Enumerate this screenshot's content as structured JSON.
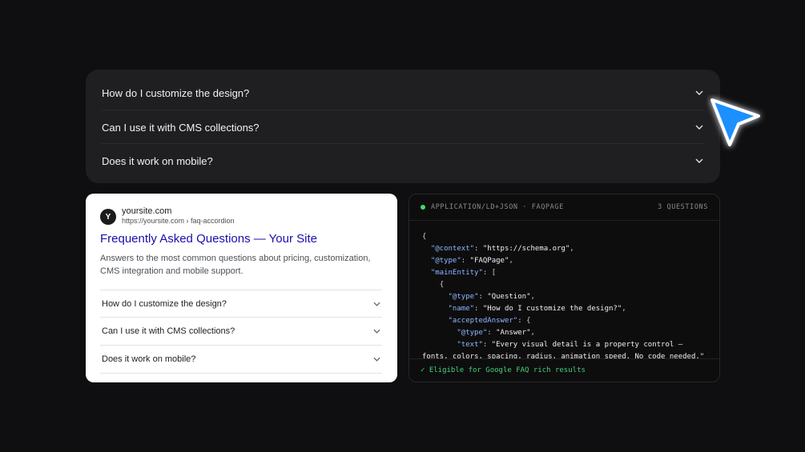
{
  "faq": {
    "items": [
      {
        "question": "How do I customize the design?"
      },
      {
        "question": "Can I use it with CMS collections?"
      },
      {
        "question": "Does it work on mobile?"
      }
    ]
  },
  "serp": {
    "favicon_letter": "Y",
    "site_name": "yoursite.com",
    "url": "https://yoursite.com › faq-accordion",
    "title": "Frequently Asked Questions — Your Site",
    "description": "Answers to the most common questions about pricing, customization, CMS integration and mobile support.",
    "questions": [
      {
        "question": "How do I customize the design?"
      },
      {
        "question": "Can I use it with CMS collections?"
      },
      {
        "question": "Does it work on mobile?"
      }
    ]
  },
  "code_panel": {
    "label": "APPLICATION/LD+JSON · FAQPAGE",
    "count": "3 QUESTIONS",
    "lines": {
      "l1": "{",
      "l2k": "\"@context\"",
      "l2v": "\"https://schema.org\"",
      "l3k": "\"@type\"",
      "l3v": "\"FAQPage\"",
      "l4k": "\"mainEntity\"",
      "l4v": "[",
      "l5": "{",
      "l6k": "\"@type\"",
      "l6v": "\"Question\"",
      "l7k": "\"name\"",
      "l7v": "\"How do I customize the design?\"",
      "l8k": "\"acceptedAnswer\"",
      "l8v": "{",
      "l9k": "\"@type\"",
      "l9v": "\"Answer\"",
      "l10k": "\"text\"",
      "l10v": "\"Every visual detail is a property control —",
      "l11": "fonts, colors, spacing, radius, animation speed. No code needed.\""
    },
    "footer": "✓ Eligible for Google FAQ rich results"
  },
  "colors": {
    "background": "#0f0f11",
    "accent_cursor": "#1e90ff",
    "serp_link": "#1a0dab",
    "status_green": "#3ddc68"
  },
  "icons": [
    "chevron-down-icon",
    "cursor-pointer-icon",
    "status-dot-icon",
    "check-icon"
  ]
}
